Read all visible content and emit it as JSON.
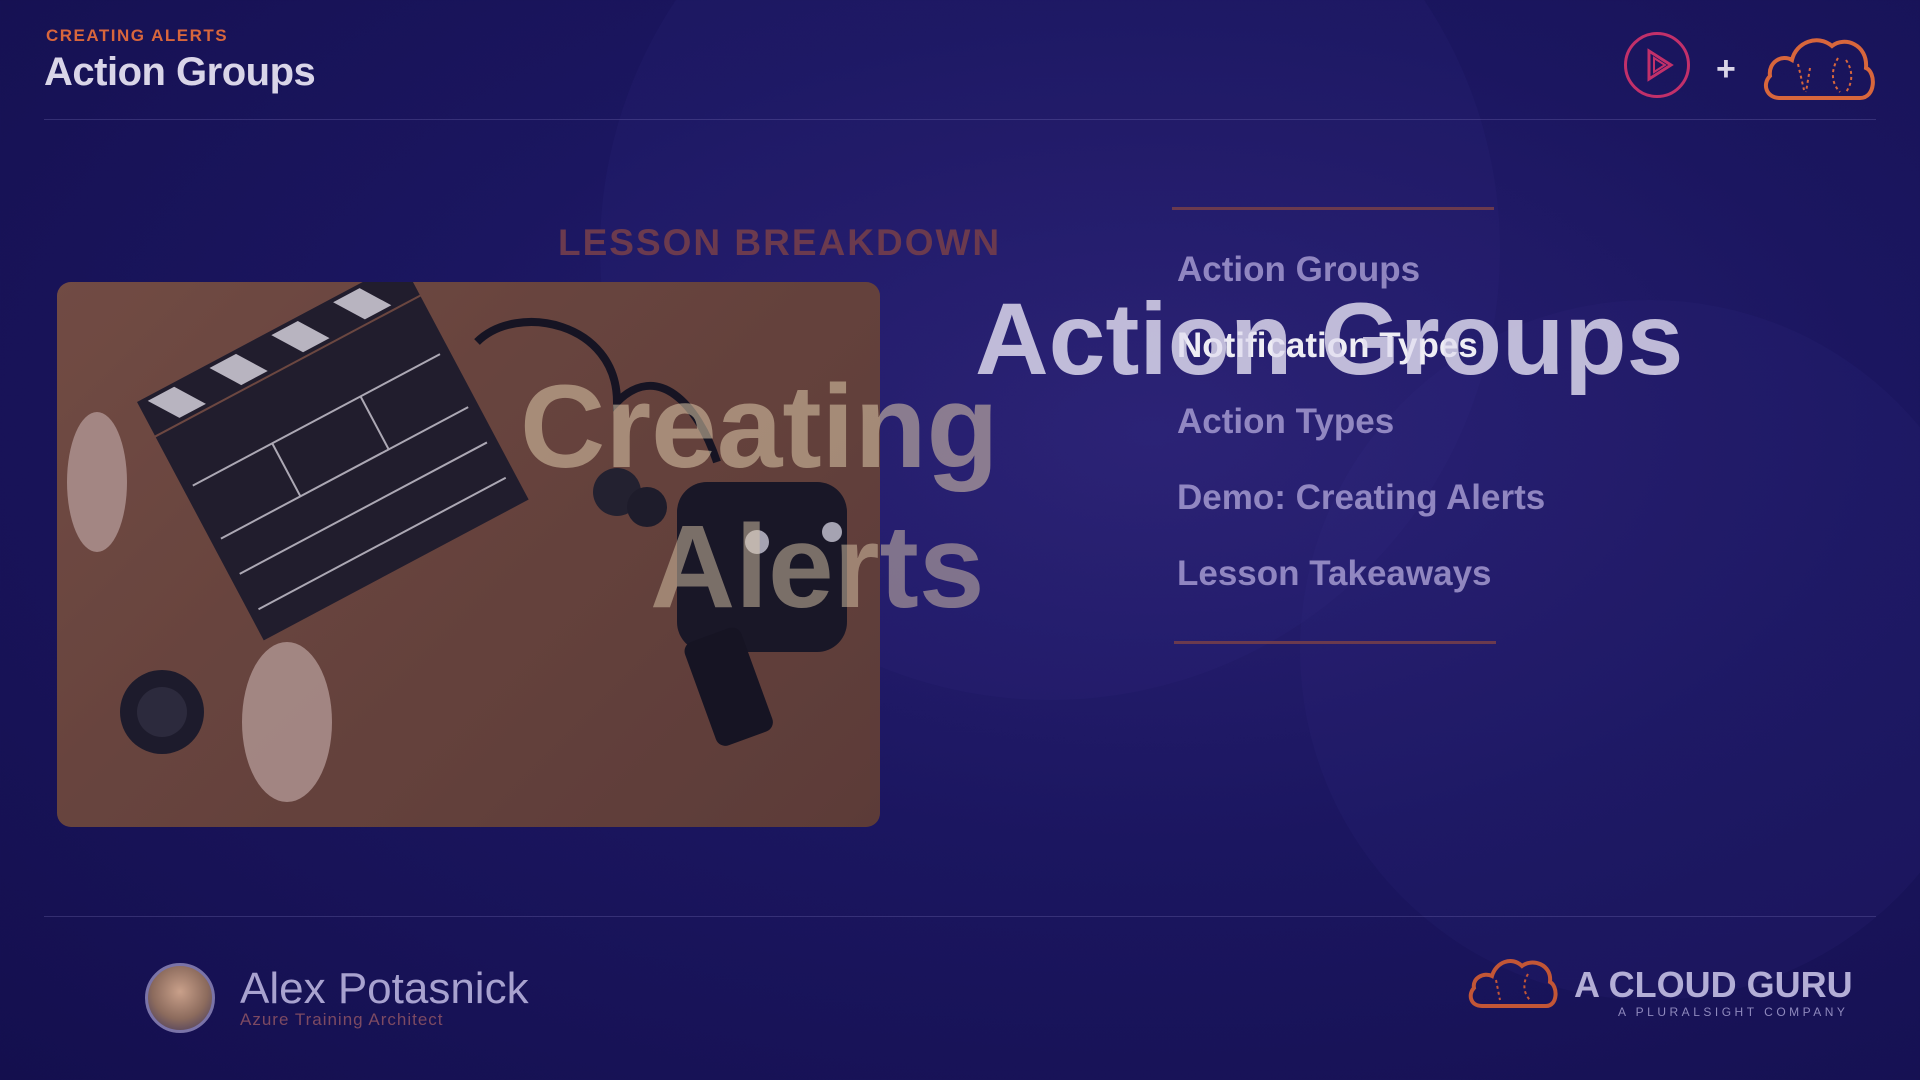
{
  "header": {
    "eyebrow": "CREATING ALERTS",
    "title": "Action Groups"
  },
  "slide": {
    "section_heading": "LESSON BREAKDOWN",
    "overlay_title_line1": "Creating",
    "overlay_title_line2": "Alerts",
    "overlay_subtitle": "Action Groups",
    "agenda": [
      {
        "label": "Action Groups",
        "active": false
      },
      {
        "label": "Notification Types",
        "active": true
      },
      {
        "label": "Action Types",
        "active": false
      },
      {
        "label": "Demo: Creating Alerts",
        "active": false
      },
      {
        "label": "Lesson Takeaways",
        "active": false
      }
    ]
  },
  "presenter": {
    "name": "Alex Potasnick",
    "role": "Azure Training Architect"
  },
  "brand": {
    "name": "A CLOUD GURU",
    "tagline": "A PLURALSIGHT COMPANY"
  },
  "colors": {
    "accent_orange": "#d8663c",
    "pluralsight_pink": "#c2306a",
    "background": "#1b1660"
  },
  "icons": {
    "pluralsight_logo": "play-circle-icon",
    "acg_logo": "cloud-icon"
  }
}
